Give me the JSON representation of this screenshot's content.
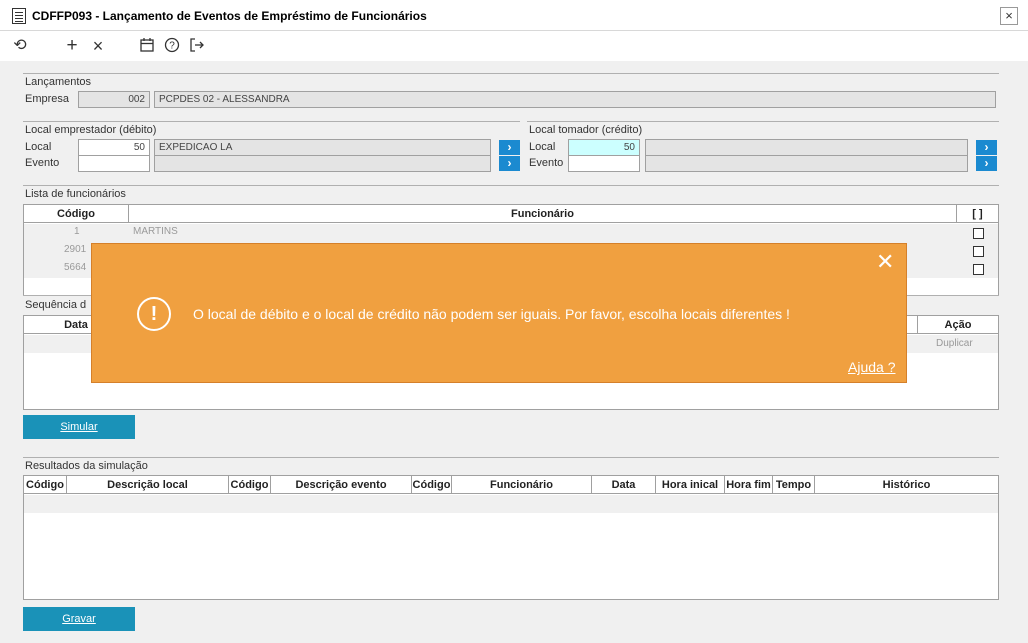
{
  "window": {
    "title": "CDFFP093 - Lançamento de Eventos de Empréstimo de Funcionários",
    "close": "×"
  },
  "toolbar": {
    "refresh": "⟲",
    "add": "+",
    "remove": "×",
    "calendar": "▭",
    "help": "?",
    "exit": "↦"
  },
  "lancamentos": {
    "title": "Lançamentos",
    "empresa_label": "Empresa",
    "empresa_code": "002",
    "empresa_name": "PCPDES 02 - ALESSANDRA"
  },
  "debito": {
    "title": "Local emprestador (débito)",
    "local_label": "Local",
    "local_code": "50",
    "local_name": "EXPEDICAO LA",
    "evento_label": "Evento",
    "evento_code": "",
    "evento_name": ""
  },
  "credito": {
    "title": "Local tomador (crédito)",
    "local_label": "Local",
    "local_code": "50",
    "local_name": "",
    "evento_label": "Evento",
    "evento_code": "",
    "evento_name": ""
  },
  "funcionarios": {
    "title": "Lista de funcionários",
    "headers": {
      "codigo": "Código",
      "funcionario": "Funcionário",
      "check": "[ ]"
    },
    "rows": [
      {
        "codigo": "1",
        "nome": "MARTINS"
      },
      {
        "codigo": "2901",
        "nome": ""
      },
      {
        "codigo": "5664",
        "nome": ""
      }
    ]
  },
  "sequencia": {
    "title": "Sequência d",
    "headers": {
      "data": "Data",
      "acao": "Ação"
    },
    "duplicar": "Duplicar"
  },
  "simular_button": "Simular",
  "resultados": {
    "title": "Resultados da simulação",
    "headers": [
      "Código",
      "Descrição local",
      "Código",
      "Descrição evento",
      "Código",
      "Funcionário",
      "Data",
      "Hora inical",
      "Hora fim",
      "Tempo",
      "Histórico"
    ]
  },
  "gravar_button": "Gravar",
  "alert": {
    "message": "O local de débito e o local de crédito não podem ser iguais. Por favor, escolha locais diferentes !",
    "help": "Ajuda ?",
    "icon": "!",
    "close": "✕",
    "color": "#f0a040"
  }
}
